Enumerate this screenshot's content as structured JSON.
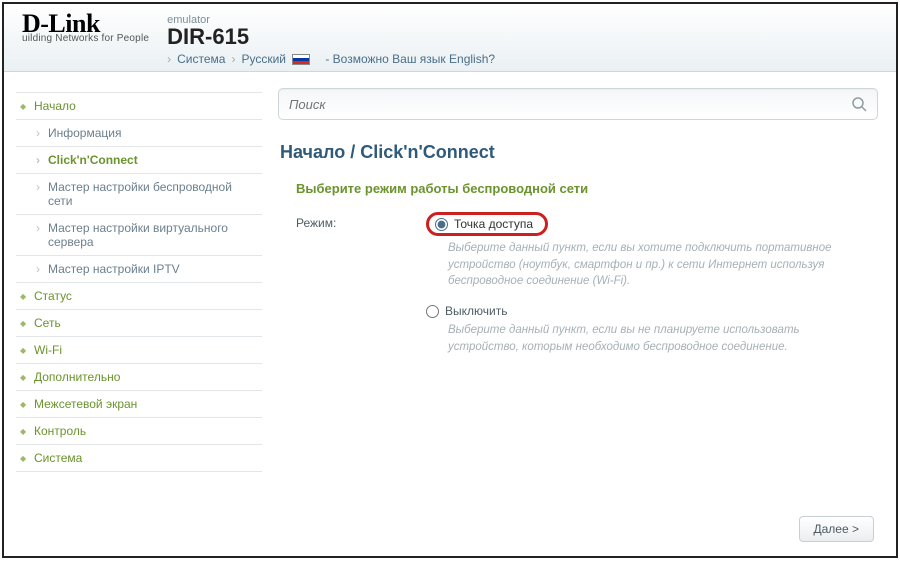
{
  "header": {
    "logo": "D-Link",
    "logo_sub": "uilding Networks for People",
    "emulator": "emulator",
    "model": "DIR-615",
    "crumb_system": "Система",
    "crumb_lang": "Русский",
    "lang_prompt": "- Возможно Ваш язык English?"
  },
  "search": {
    "placeholder": "Поиск"
  },
  "sidebar": {
    "items": [
      {
        "label": "Начало",
        "type": "top"
      },
      {
        "label": "Информация",
        "type": "sub"
      },
      {
        "label": "Click'n'Connect",
        "type": "sub",
        "active": true
      },
      {
        "label": "Мастер настройки беспроводной сети",
        "type": "sub"
      },
      {
        "label": "Мастер настройки виртуального сервера",
        "type": "sub"
      },
      {
        "label": "Мастер настройки IPTV",
        "type": "sub"
      },
      {
        "label": "Статус",
        "type": "top"
      },
      {
        "label": "Сеть",
        "type": "top"
      },
      {
        "label": "Wi-Fi",
        "type": "top"
      },
      {
        "label": "Дополнительно",
        "type": "top"
      },
      {
        "label": "Межсетевой экран",
        "type": "top"
      },
      {
        "label": "Контроль",
        "type": "top"
      },
      {
        "label": "Система",
        "type": "top"
      }
    ]
  },
  "main": {
    "breadcrumb": "Начало /  Click'n'Connect",
    "section_title": "Выберите режим работы беспроводной сети",
    "mode_label": "Режим:",
    "options": [
      {
        "label": "Точка доступа",
        "checked": true,
        "highlight": true,
        "desc": "Выберите данный пункт, если вы хотите подключить портативное устройство (ноутбук, смартфон и пр.) к сети Интернет используя беспроводное соединение (Wi-Fi)."
      },
      {
        "label": "Выключить",
        "checked": false,
        "highlight": false,
        "desc": "Выберите данный пункт, если вы не планируете использовать устройство, которым необходимо беспроводное соединение."
      }
    ],
    "next": "Далее >"
  }
}
